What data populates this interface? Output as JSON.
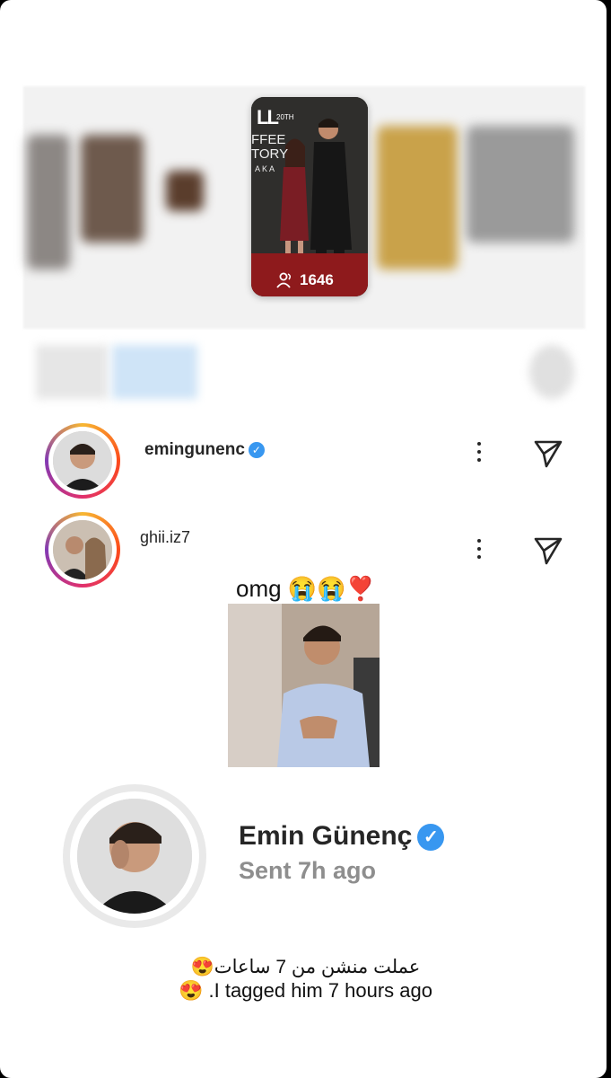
{
  "story": {
    "viewer_count": "1646",
    "logo_text": "LL",
    "anniv": "20TH",
    "brand_line1": "FFEE",
    "brand_line2": "TORY",
    "brand_line3": "A K A"
  },
  "rows": [
    {
      "username": "emingunenc",
      "verified": true
    },
    {
      "username": "ghii.iz7",
      "verified": false
    }
  ],
  "post": {
    "caption": "omg 😭😭❣️"
  },
  "profile": {
    "name": "Emin Günenç",
    "sent": "Sent 7h ago"
  },
  "footer": {
    "arabic": "عملت منشن من 7 ساعات😍",
    "english": "😍 .I tagged him 7 hours ago"
  },
  "colors": {
    "verified": "#3897f0",
    "ring": "#e1306c"
  },
  "icons": [
    "verified-icon",
    "more-vert-icon",
    "send-icon",
    "people-icon"
  ]
}
